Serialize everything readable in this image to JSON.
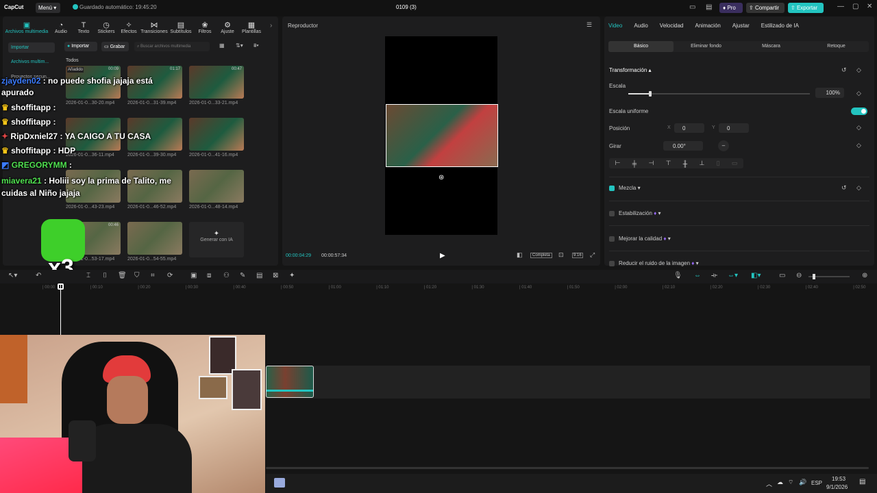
{
  "app": {
    "logo": "CapCut",
    "menu_label": "Menú",
    "autosave": "Guardado automático: 19:45:20",
    "project_title": "0109 (3)",
    "pro_label": "Pro",
    "share_label": "Compartir",
    "export_label": "Exportar"
  },
  "toolbar_tabs": [
    "Archivos multimedia",
    "Audio",
    "Texto",
    "Stickers",
    "Efectos",
    "Transiciones",
    "Subtítulos",
    "Filtros",
    "Ajuste",
    "Plantillas"
  ],
  "media": {
    "import_label": "Importar",
    "record_label": "Grabar",
    "search_placeholder": "Buscar archivos multimedia",
    "all_label": "Todos",
    "added_label": "Añadido",
    "sidebar": {
      "import": "Importar",
      "local": "Archivos multim...",
      "projects": "Proyectos secun..."
    },
    "generate_label": "Generar con IA",
    "clips": [
      {
        "name": "2026-01-0...30-20.mp4",
        "duration": "00:09"
      },
      {
        "name": "2026-01-0...31-39.mp4",
        "duration": "01:17"
      },
      {
        "name": "2026-01-0...33-21.mp4",
        "duration": "00:47"
      },
      {
        "name": "2026-01-0...36-11.mp4",
        "duration": ""
      },
      {
        "name": "2026-01-0...39-30.mp4",
        "duration": ""
      },
      {
        "name": "2026-01-0...41-16.mp4",
        "duration": ""
      },
      {
        "name": "2026-01-0...43-23.mp4",
        "duration": ""
      },
      {
        "name": "2026-01-0...46-52.mp4",
        "duration": ""
      },
      {
        "name": "2026-01-0...48-14.mp4",
        "duration": ""
      },
      {
        "name": "2026-01-0...53-17.mp4",
        "duration": "00:46"
      },
      {
        "name": "2026-01-0...54-55.mp4",
        "duration": ""
      }
    ]
  },
  "chat": [
    {
      "user": "zjayden02",
      "text": ": no puede shofia jajaja está apurado",
      "color": "#3b7bff"
    },
    {
      "user": "shoffitapp",
      "text": ":",
      "color": "#ffffff"
    },
    {
      "user": "shoffitapp",
      "text": ":",
      "color": "#ffffff"
    },
    {
      "user": "RipDxniel27",
      "text": ": YA CAIGO A TU CASA",
      "color": "#ffffff"
    },
    {
      "user": "shoffitapp",
      "text": ": HDP",
      "color": "#ffffff"
    },
    {
      "user": "GREGORYMM",
      "text": ":",
      "color": "#4fe04f"
    },
    {
      "user": "miavera21",
      "text": ": Holiii soy la prima de Talito, me cuidas al Niño jajaja",
      "color": "#4fe04f"
    }
  ],
  "sticker_multiplier": "x3",
  "player": {
    "title": "Reproductor",
    "current_time": "00:00:04:29",
    "total_time": "00:00:57:34",
    "full_label": "Completa",
    "ratio_label": "9:16"
  },
  "right_panel": {
    "tabs": [
      "Video",
      "Audio",
      "Velocidad",
      "Animación",
      "Ajustar",
      "Estilizado de IA"
    ],
    "subtabs": [
      "Básico",
      "Eliminar fondo",
      "Máscara",
      "Retoque"
    ],
    "transform_label": "Transformación",
    "scale_label": "Escala",
    "scale_value": "100%",
    "scale_fraction": 0.12,
    "uniform_label": "Escala uniforme",
    "position_label": "Posición",
    "pos_x_label": "X",
    "pos_x": "0",
    "pos_y_label": "Y",
    "pos_y": "0",
    "rotate_label": "Girar",
    "rotate_value": "0.00°",
    "blend_label": "Mezcla",
    "stabilize_label": "Estabilización",
    "quality_label": "Mejorar la calidad",
    "noise_label": "Reducir el ruido de la imagen"
  },
  "timeline": {
    "ticks": [
      "00:00",
      "00:10",
      "00:20",
      "00:30",
      "00:40",
      "00:50",
      "01:00",
      "01:10",
      "01:20",
      "01:30",
      "01:40",
      "01:50",
      "02:00",
      "02:10",
      "02:20",
      "02:30",
      "02:40",
      "02:50"
    ]
  },
  "taskbar": {
    "lang": "ESP",
    "time": "19:53",
    "date": "9/1/2026"
  },
  "colors": {
    "accent": "#23c4c0",
    "panel": "#1d1d1e",
    "bg": "#151515"
  }
}
